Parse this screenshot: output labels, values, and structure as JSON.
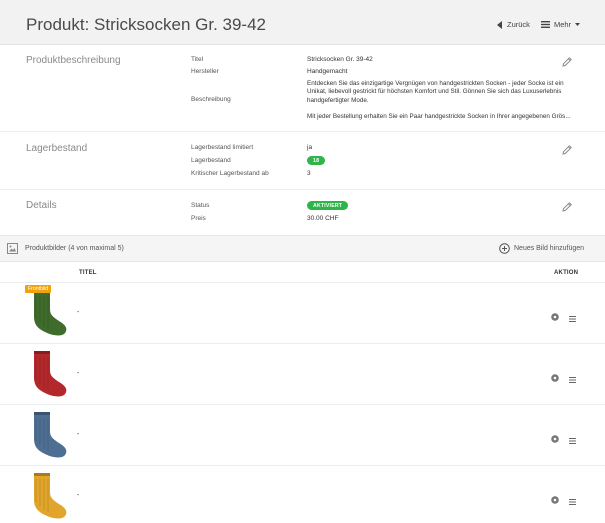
{
  "header": {
    "title": "Produkt: Stricksocken Gr. 39-42",
    "back_label": "Zurück",
    "more_label": "Mehr"
  },
  "description_section": {
    "title": "Produktbeschreibung",
    "fields": [
      {
        "label": "Titel",
        "value": "Stricksocken Gr. 39-42"
      },
      {
        "label": "Hersteller",
        "value": "Handgemacht"
      },
      {
        "label": "Beschreibung",
        "value": ""
      }
    ],
    "description_text": "Entdecken Sie das einzigartige Vergnügen von handgestrickten Socken - jeder Socke ist ein Unikat, liebevoll gestrickt für höchsten Komfort und Stil. Gönnen Sie sich das Luxuserlebnis handgefertigter Mode.",
    "description_text_2": "Mit jeder Bestellung erhalten Sie ein Paar handgestrickte Socken in Ihrer angegebenen Grös..."
  },
  "stock_section": {
    "title": "Lagerbestand",
    "fields": [
      {
        "label": "Lagerbestand limitiert",
        "value": "ja"
      },
      {
        "label": "Lagerbestand",
        "value": "18"
      },
      {
        "label": "Kritischer Lagerbestand ab",
        "value": "3"
      }
    ]
  },
  "details_section": {
    "title": "Details",
    "fields": [
      {
        "label": "Status",
        "value": "AKTIVIERT"
      },
      {
        "label": "Preis",
        "value": "30.00 CHF"
      }
    ]
  },
  "images_section": {
    "title": "Produktbilder (4 von maximal 5)",
    "add_label": "Neues Bild hinzufügen",
    "columns": [
      "TITEL",
      "AKTION"
    ],
    "front_badge": "Frontbild",
    "rows": [
      {
        "title": "-",
        "sock_color": "#3f6b2c"
      },
      {
        "title": "-",
        "sock_color": "#b3282a"
      },
      {
        "title": "-",
        "sock_color": "#4e6f93"
      },
      {
        "title": "-",
        "sock_color": "#e0a52a"
      }
    ]
  },
  "colors": {
    "accent_green": "#2eb54a",
    "badge_orange": "#f0a30a"
  },
  "icons": [
    "chevron-left-icon",
    "menu-icon",
    "caret-down-icon",
    "pencil-icon",
    "image-icon",
    "plus-circle-icon",
    "settings-icon",
    "list-icon"
  ]
}
